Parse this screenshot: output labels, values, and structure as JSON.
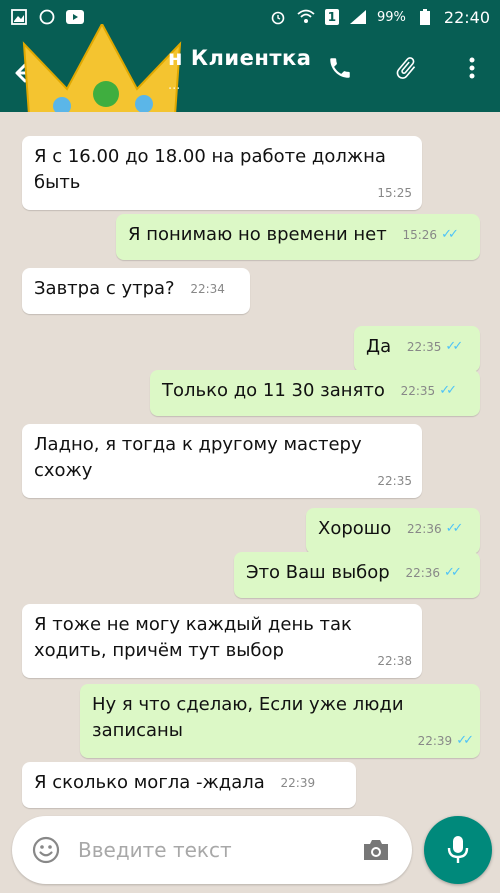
{
  "status_bar": {
    "battery": "99%",
    "time": "22:40",
    "sim": "1"
  },
  "header": {
    "contact_name": "н Клиентка",
    "contact_sub": "..."
  },
  "messages": [
    {
      "dir": "in",
      "text": "Я с 16.00 до 18.00 на работе должна быть",
      "time": "15:25"
    },
    {
      "dir": "out",
      "text": "Я понимаю но времени нет",
      "time": "15:26"
    },
    {
      "dir": "in",
      "text": "Завтра с утра?",
      "time": "22:34"
    },
    {
      "dir": "out",
      "text": "Да",
      "time": "22:35"
    },
    {
      "dir": "out",
      "text": "Только до 11 30 занято",
      "time": "22:35"
    },
    {
      "dir": "in",
      "text": "Ладно, я тогда к другому мастеру схожу",
      "time": "22:35"
    },
    {
      "dir": "out",
      "text": "Хорошо",
      "time": "22:36"
    },
    {
      "dir": "out",
      "text": "Это Ваш выбор",
      "time": "22:36"
    },
    {
      "dir": "in",
      "text": "Я тоже не могу каждый день так ходить, причём тут выбор",
      "time": "22:38"
    },
    {
      "dir": "out",
      "text": "Ну я что сделаю, Если уже люди записаны",
      "time": "22:39"
    },
    {
      "dir": "in",
      "text": "Я сколько могла -ждала",
      "time": "22:39"
    }
  ],
  "input": {
    "placeholder": "Введите текст"
  },
  "colors": {
    "header": "#075e54",
    "incoming": "#ffffff",
    "outgoing": "#dcf8c6",
    "mic": "#00897b",
    "ticks": "#4fc3f7"
  }
}
